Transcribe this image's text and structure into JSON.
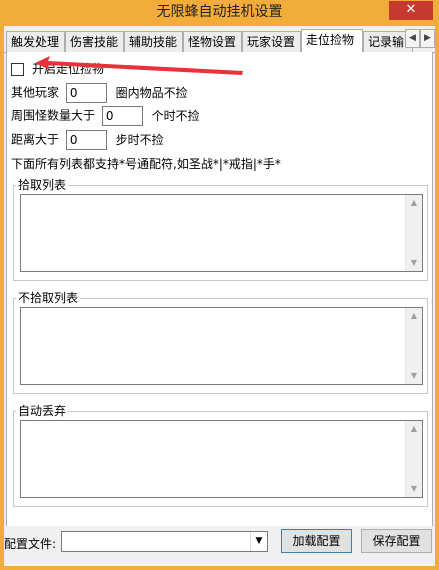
{
  "window": {
    "title": "无限蜂自动挂机设置",
    "close_label": "✕"
  },
  "tabs": [
    {
      "label": "触发处理"
    },
    {
      "label": "伤害技能"
    },
    {
      "label": "辅助技能"
    },
    {
      "label": "怪物设置"
    },
    {
      "label": "玩家设置"
    },
    {
      "label": "走位捡物"
    },
    {
      "label": "记录输"
    }
  ],
  "tab_scroll": {
    "left": "◀",
    "right": "▶"
  },
  "pickup": {
    "enable_label": "开启走位捡物",
    "other_player_label": "其他玩家",
    "other_player_value": "0",
    "other_player_suffix": "圈内物品不捡",
    "monster_count_label": "周围怪数量大于",
    "monster_count_value": "0",
    "monster_count_suffix": "个时不捡",
    "distance_label": "距离大于",
    "distance_value": "0",
    "distance_suffix": "步时不捡",
    "wildcard_hint": "下面所有列表都支持*号通配符,如圣战*|*戒指|*手*"
  },
  "lists": {
    "pickup_title": "拾取列表",
    "nopickup_title": "不拾取列表",
    "autodrop_title": "自动丢弃"
  },
  "bottom": {
    "config_label": "配置文件:",
    "config_value": "",
    "load_button": "加载配置",
    "save_button": "保存配置"
  },
  "colors": {
    "title_bar": "#f2ac3a",
    "close_button": "#c7392e",
    "annotation_arrow": "#e8313a"
  }
}
